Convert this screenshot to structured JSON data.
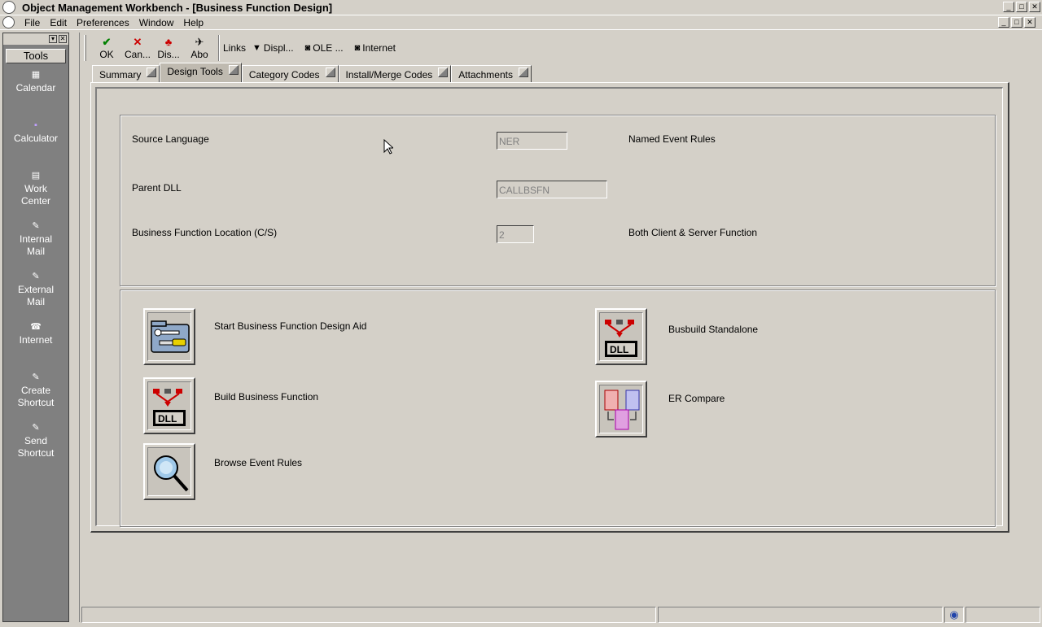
{
  "window": {
    "title": "Object Management Workbench - [Business Function Design]",
    "title_buttons": [
      "_",
      "□",
      "✕"
    ],
    "mdi_buttons": [
      "_",
      "□",
      "✕"
    ]
  },
  "menubar": {
    "items": [
      "File",
      "Edit",
      "Preferences",
      "Window",
      "Help"
    ]
  },
  "sidebar": {
    "header": "Tools",
    "items": [
      {
        "label": "Calendar",
        "icon": "calendar-icon"
      },
      {
        "label": "Calculator",
        "icon": "calculator-icon"
      },
      {
        "label": "Work Center",
        "icon": "work-center-icon"
      },
      {
        "label": "Internal Mail",
        "icon": "mail-icon"
      },
      {
        "label": "External Mail",
        "icon": "mail-icon"
      },
      {
        "label": "Internet",
        "icon": "phone-icon"
      },
      {
        "label": "Create Shortcut",
        "icon": "shortcut-icon"
      },
      {
        "label": "Send Shortcut",
        "icon": "shortcut-icon"
      }
    ]
  },
  "toolbar": {
    "ok_label": "OK",
    "cancel_label": "Can...",
    "display_label": "Dis...",
    "about_label": "Abo",
    "links_label": "Links",
    "displ_label": "Displ...",
    "ole_label": "OLE ...",
    "internet_label": "Internet"
  },
  "tabs": [
    {
      "label": "Summary",
      "active": false
    },
    {
      "label": "Design Tools",
      "active": true
    },
    {
      "label": "Category Codes",
      "active": false
    },
    {
      "label": "Install/Merge Codes",
      "active": false
    },
    {
      "label": "Attachments",
      "active": false
    }
  ],
  "form": {
    "source_language": {
      "label": "Source Language",
      "value": "NER",
      "description": "Named Event Rules"
    },
    "parent_dll": {
      "label": "Parent DLL",
      "value": "CALLBSFN"
    },
    "location": {
      "label": "Business Function Location (C/S)",
      "value": "2",
      "description": "Both Client & Server Function"
    }
  },
  "design_tools": {
    "start_design_aid": "Start Business Function Design Aid",
    "build_business_function": "Build Business Function",
    "browse_event_rules": "Browse Event Rules",
    "busbuild_standalone": "Busbuild Standalone",
    "er_compare": "ER Compare"
  },
  "colors": {
    "face": "#d4d0c8",
    "sidebar": "#808080",
    "ok_green": "#008000",
    "cancel_red": "#cc0000"
  }
}
